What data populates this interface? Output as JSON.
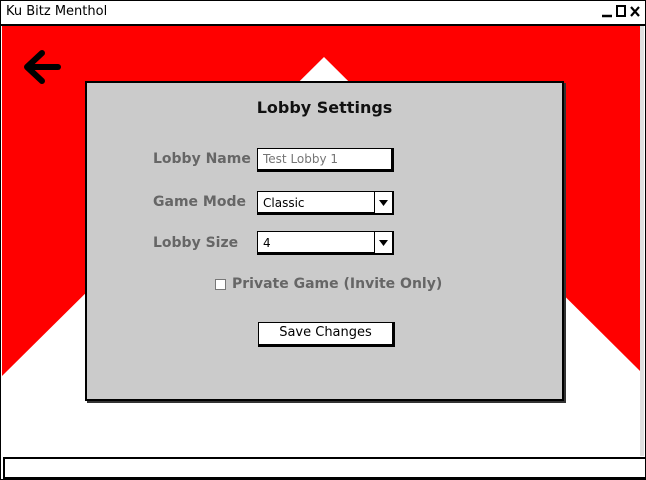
{
  "window": {
    "title": "Ku Bitz Menthol"
  },
  "colors": {
    "background_red": "#ff0000",
    "dialog_bg": "#cbcbcb",
    "label_gray": "#666666"
  },
  "icons": {
    "back": "arrow-left-icon",
    "minimize": "minimize-icon",
    "maximize": "maximize-icon",
    "close": "close-icon"
  },
  "dialog": {
    "title": "Lobby Settings",
    "lobby_name": {
      "label": "Lobby Name",
      "placeholder": "Test Lobby 1",
      "value": ""
    },
    "game_mode": {
      "label": "Game Mode",
      "value": "Classic"
    },
    "lobby_size": {
      "label": "Lobby Size",
      "value": "4"
    },
    "private_game": {
      "label": "Private Game (Invite Only)",
      "checked": false
    },
    "save_label": "Save Changes"
  }
}
